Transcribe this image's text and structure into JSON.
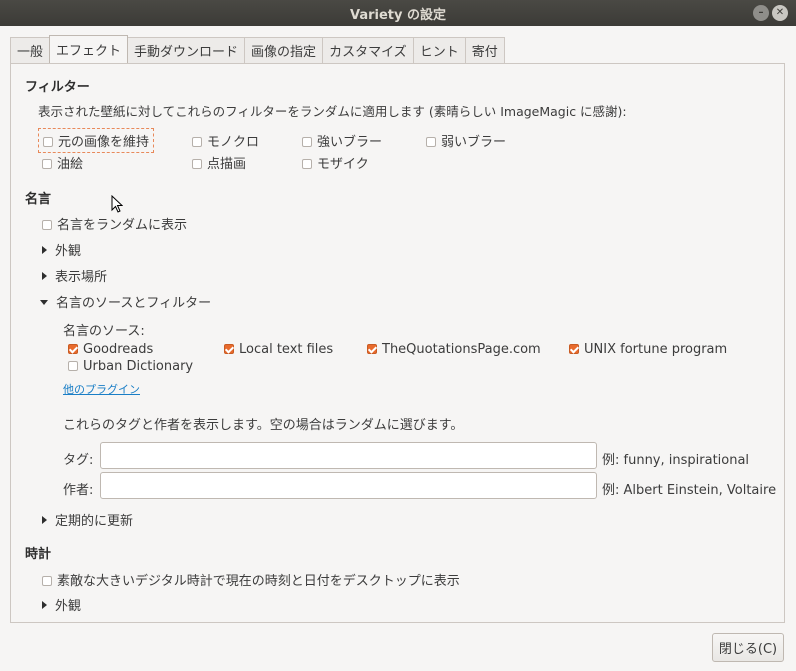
{
  "window": {
    "title": "Variety の設定"
  },
  "tabs": [
    "一般",
    "エフェクト",
    "手動ダウンロード",
    "画像の指定",
    "カスタマイズ",
    "ヒント",
    "寄付"
  ],
  "active_tab": "エフェクト",
  "filters": {
    "title": "フィルター",
    "description": "表示された壁紙に対してこれらのフィルターをランダムに適用します (素晴らしい ImageMagic に感謝):",
    "options": [
      {
        "label": "元の画像を維持",
        "checked": false
      },
      {
        "label": "モノクロ",
        "checked": false
      },
      {
        "label": "強いブラー",
        "checked": false
      },
      {
        "label": "弱いブラー",
        "checked": false
      },
      {
        "label": "油絵",
        "checked": false
      },
      {
        "label": "点描画",
        "checked": false
      },
      {
        "label": "モザイク",
        "checked": false
      }
    ]
  },
  "quotes": {
    "title": "名言",
    "random_label": "名言をランダムに表示",
    "random_checked": false,
    "appearance_label": "外観",
    "location_label": "表示場所",
    "sources_label": "名言のソースとフィルター",
    "sources_title": "名言のソース:",
    "sources": [
      {
        "label": "Goodreads",
        "checked": true
      },
      {
        "label": "Local text files",
        "checked": true
      },
      {
        "label": "TheQuotationsPage.com",
        "checked": true
      },
      {
        "label": "UNIX fortune program",
        "checked": true
      },
      {
        "label": "Urban Dictionary",
        "checked": false
      }
    ],
    "more_plugins": "他のプラグイン",
    "tags_note": "これらのタグと作者を表示します。空の場合はランダムに選びます。",
    "tag_label": "タグ:",
    "tag_value": "",
    "tag_example": "例: funny, inspirational",
    "author_label": "作者:",
    "author_value": "",
    "author_example": "例: Albert Einstein, Voltaire",
    "refresh_label": "定期的に更新"
  },
  "clock": {
    "title": "時計",
    "show_label": "素敵な大きいデジタル時計で現在の時刻と日付をデスクトップに表示",
    "show_checked": false,
    "appearance_label": "外観"
  },
  "close_button": "閉じる(C)",
  "colors": {
    "accent": "#e86a2c",
    "link": "#1a7ec6",
    "titlebar": "#3c3b37"
  }
}
